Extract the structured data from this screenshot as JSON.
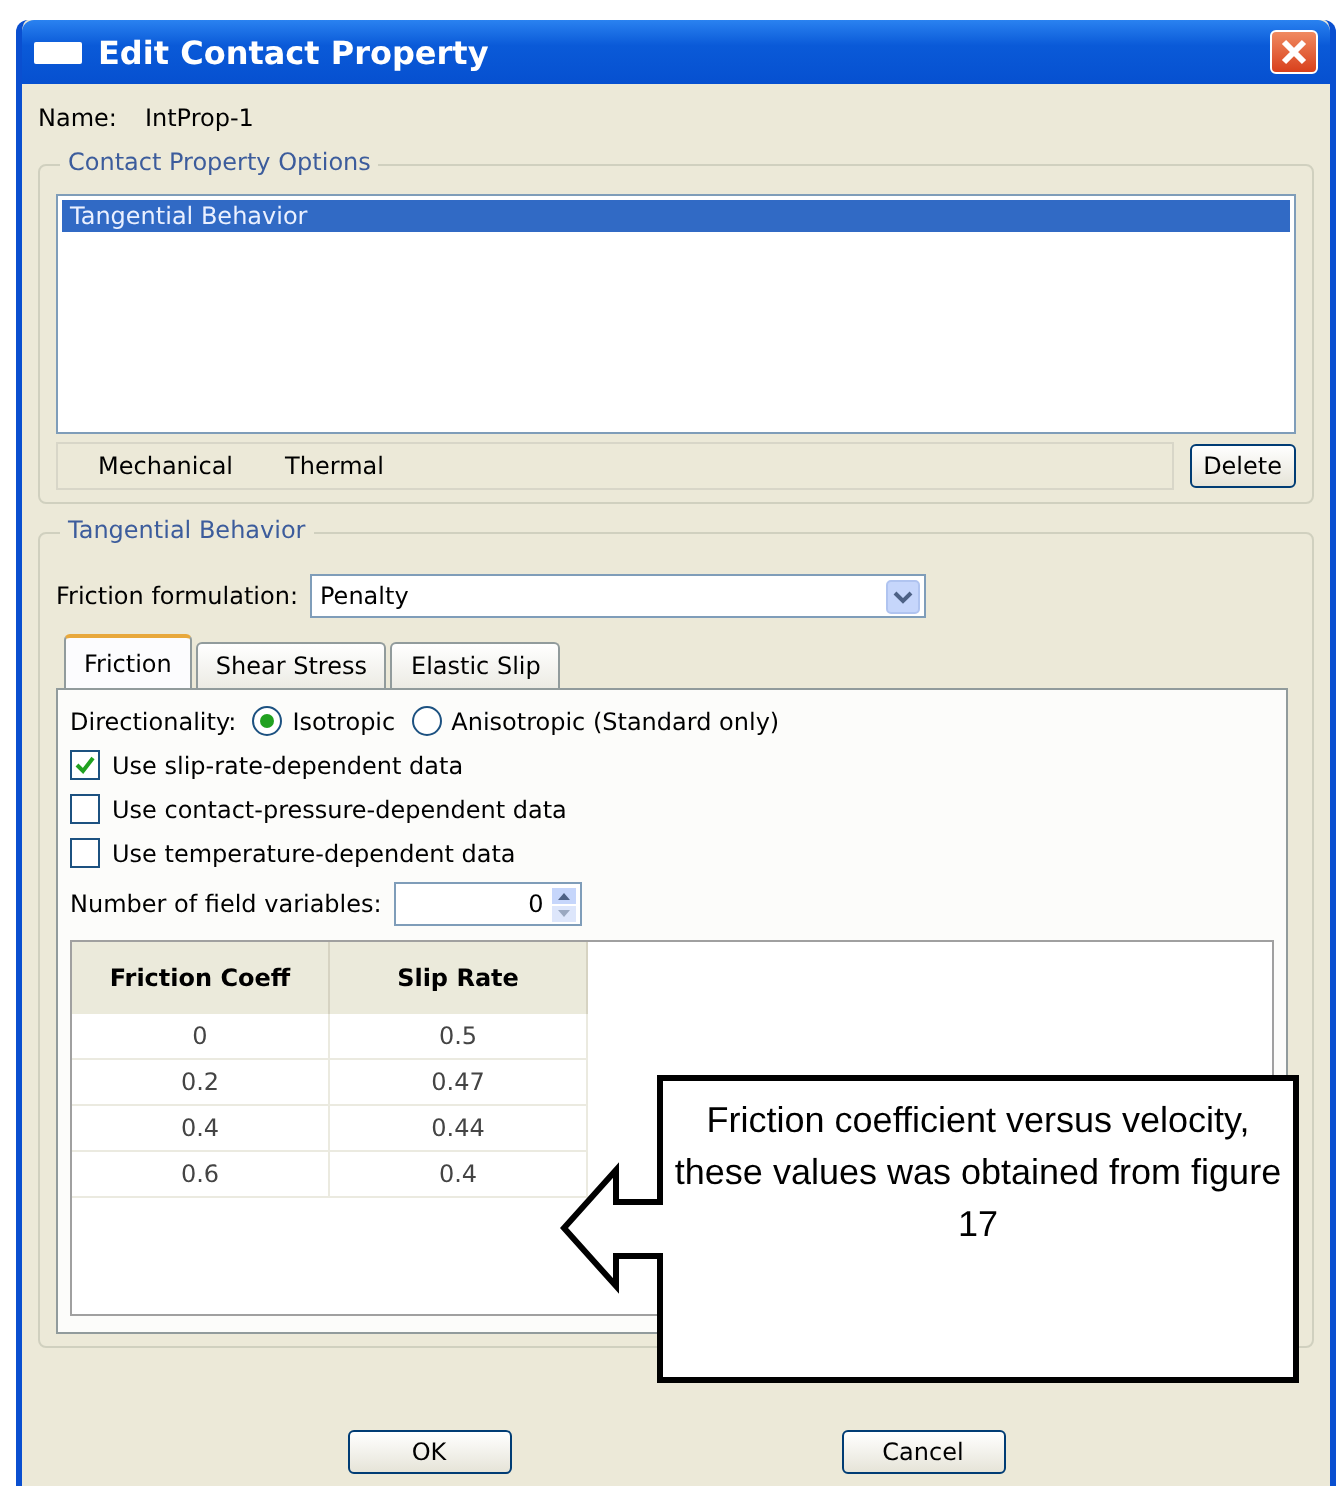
{
  "window": {
    "title": "Edit Contact Property"
  },
  "name": {
    "label": "Name:",
    "value": "IntProp-1"
  },
  "options": {
    "title": "Contact Property Options",
    "items": [
      {
        "label": "Tangential Behavior",
        "selected": true
      }
    ],
    "menus": [
      "Mechanical",
      "Thermal"
    ],
    "delete_button": "Delete"
  },
  "tangential": {
    "title": "Tangential Behavior",
    "formulation": {
      "label": "Friction formulation:",
      "value": "Penalty"
    },
    "tabs": [
      {
        "label": "Friction",
        "selected": true
      },
      {
        "label": "Shear Stress",
        "selected": false
      },
      {
        "label": "Elastic Slip",
        "selected": false
      }
    ],
    "directionality": {
      "label": "Directionality:",
      "options": [
        {
          "label": "Isotropic",
          "selected": true
        },
        {
          "label": "Anisotropic (Standard only)",
          "selected": false
        }
      ]
    },
    "checkboxes": [
      {
        "label": "Use slip-rate-dependent data",
        "checked": true
      },
      {
        "label": "Use contact-pressure-dependent data",
        "checked": false
      },
      {
        "label": "Use temperature-dependent data",
        "checked": false
      }
    ],
    "field_variables": {
      "label": "Number of field variables:",
      "value": "0"
    },
    "table": {
      "columns": [
        "Friction Coeff",
        "Slip Rate"
      ],
      "rows": [
        [
          "0",
          "0.5"
        ],
        [
          "0.2",
          "0.47"
        ],
        [
          "0.4",
          "0.44"
        ],
        [
          "0.6",
          "0.4"
        ]
      ]
    }
  },
  "callout": {
    "text": "Friction coefficient versus velocity, these values was obtained from figure 17"
  },
  "buttons": [
    "OK",
    "Cancel"
  ]
}
